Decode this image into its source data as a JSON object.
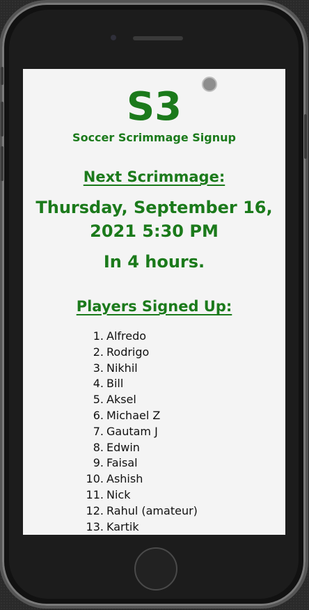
{
  "app": {
    "logo": "S3",
    "subtitle": "Soccer Scrimmage Signup"
  },
  "next_scrimmage": {
    "heading": "Next Scrimmage:",
    "date_line1": "Thursday, September 16,",
    "date_line2": "2021 5:30 PM",
    "countdown": "In 4 hours."
  },
  "players": {
    "heading": "Players Signed Up:",
    "items": [
      {
        "num": "1.",
        "name": "Alfredo"
      },
      {
        "num": "2.",
        "name": "Rodrigo"
      },
      {
        "num": "3.",
        "name": "Nikhil"
      },
      {
        "num": "4.",
        "name": "Bill"
      },
      {
        "num": "5.",
        "name": "Aksel"
      },
      {
        "num": "6.",
        "name": "Michael Z"
      },
      {
        "num": "7.",
        "name": "Gautam J"
      },
      {
        "num": "8.",
        "name": "Edwin"
      },
      {
        "num": "9.",
        "name": "Faisal"
      },
      {
        "num": "10.",
        "name": "Ashish"
      },
      {
        "num": "11.",
        "name": "Nick"
      },
      {
        "num": "12.",
        "name": "Rahul (amateur)"
      },
      {
        "num": "13.",
        "name": "Kartik"
      }
    ]
  },
  "colors": {
    "accent": "#1b7a1b",
    "screen_bg": "#f4f4f4",
    "text": "#111111"
  }
}
